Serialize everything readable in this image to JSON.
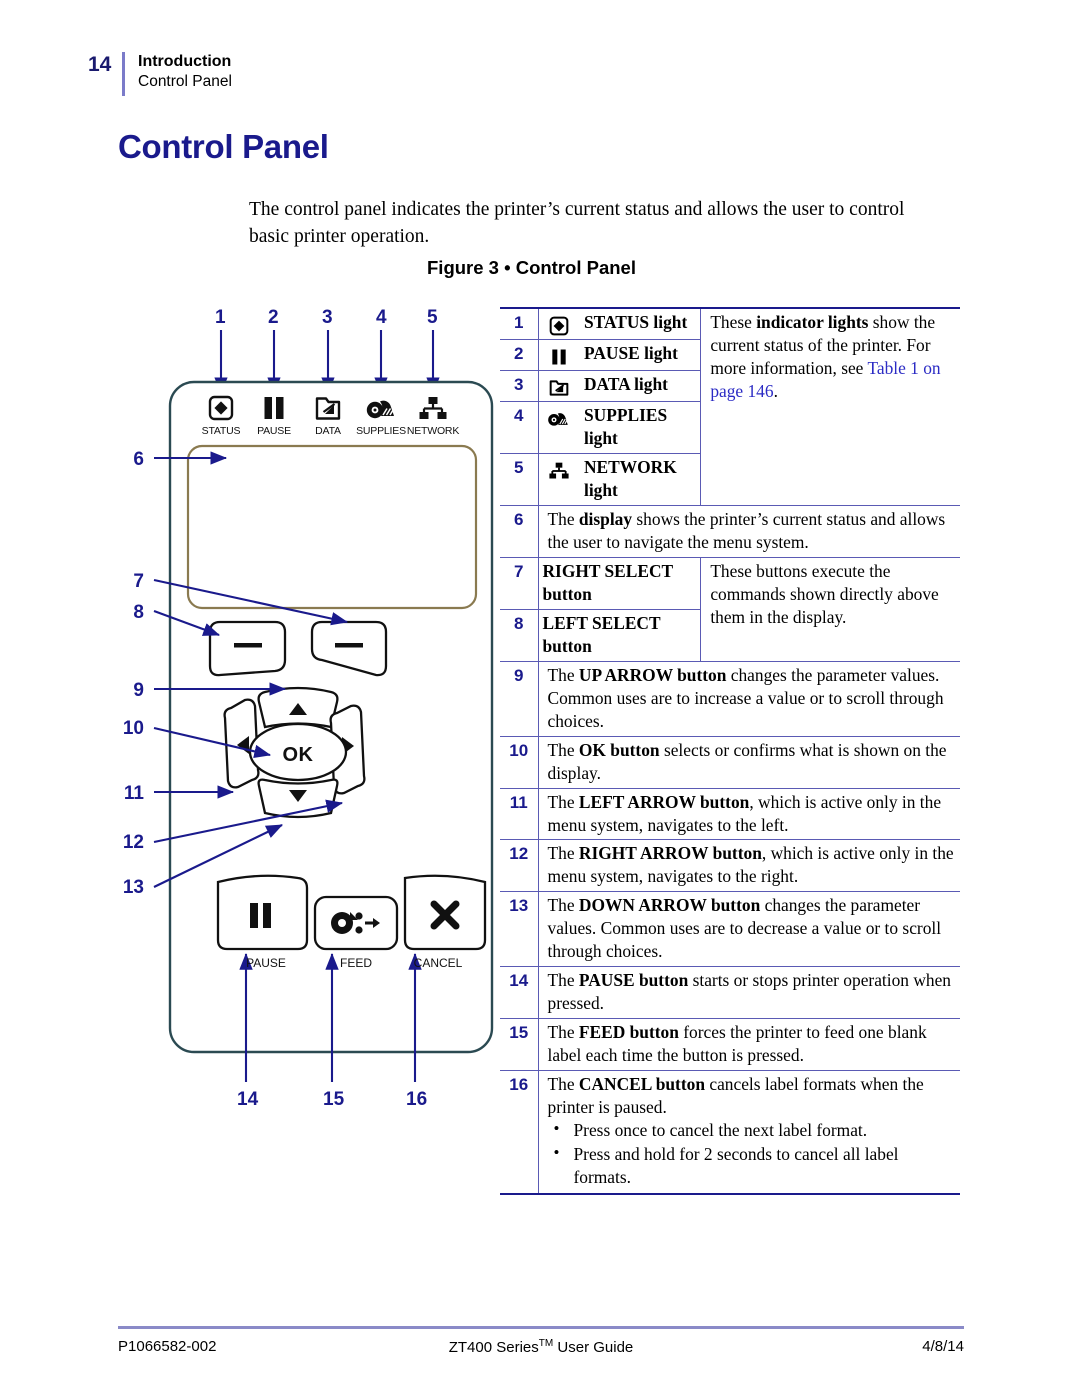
{
  "header": {
    "page_number": "14",
    "chapter": "Introduction",
    "section": "Control Panel"
  },
  "page_title": "Control Panel",
  "intro_paragraph": "The control panel indicates the printer’s current status and allows the user to control basic printer operation.",
  "figure": {
    "caption": "Figure 3 • Control Panel",
    "indicator_labels": [
      "STATUS",
      "PAUSE",
      "DATA",
      "SUPPLIES",
      "NETWORK"
    ],
    "button_labels": [
      "PAUSE",
      "FEED",
      "CANCEL"
    ],
    "ok_button_label": "OK",
    "callouts_top": [
      "1",
      "2",
      "3",
      "4",
      "5"
    ],
    "callouts_left": [
      "6",
      "7",
      "8",
      "9",
      "10",
      "11",
      "12",
      "13"
    ],
    "callouts_bottom": [
      "14",
      "15",
      "16"
    ]
  },
  "table": {
    "rows": [
      {
        "num": "1",
        "icon": "status-diamond-icon",
        "label": "STATUS light"
      },
      {
        "num": "2",
        "icon": "pause-bars-icon",
        "label": "PAUSE light"
      },
      {
        "num": "3",
        "icon": "data-folder-icon",
        "label": "DATA light"
      },
      {
        "num": "4",
        "icon": "supplies-roll-icon",
        "label": "SUPPLIES light"
      },
      {
        "num": "5",
        "icon": "network-tree-icon",
        "label": "NETWORK light"
      }
    ],
    "lights_description_1": "These ",
    "lights_description_bold": "indicator lights",
    "lights_description_2": " show the current status of the printer. For more information, see ",
    "lights_link": "Table 1 on page 146",
    "lights_description_3": ".",
    "row6": {
      "num": "6",
      "pre": "The ",
      "bold": "display",
      "post": " shows the printer’s current status and allows the user to navigate the menu system."
    },
    "row7": {
      "num": "7",
      "label": "RIGHT SELECT button"
    },
    "row8": {
      "num": "8",
      "label": "LEFT SELECT button"
    },
    "select_description": "These buttons execute the commands shown directly above them in the display.",
    "row9": {
      "num": "9",
      "pre": "The ",
      "bold": "UP ARROW button",
      "post": " changes the parameter values. Common uses are to increase a value or to scroll through choices."
    },
    "row10": {
      "num": "10",
      "pre": "The ",
      "bold": "OK button",
      "post": " selects or confirms what is shown on the display."
    },
    "row11": {
      "num": "11",
      "pre": "The ",
      "bold": "LEFT ARROW button",
      "post": ", which is active only in the menu system, navigates to the left."
    },
    "row12": {
      "num": "12",
      "pre": "The ",
      "bold": "RIGHT ARROW button",
      "post": ", which is active only in the menu system, navigates to the right."
    },
    "row13": {
      "num": "13",
      "pre": "The ",
      "bold": "DOWN ARROW button",
      "post": " changes the parameter values. Common uses are to decrease a value or to scroll through choices."
    },
    "row14": {
      "num": "14",
      "pre": "The ",
      "bold": "PAUSE button",
      "post": " starts or stops printer operation when pressed."
    },
    "row15": {
      "num": "15",
      "pre": "The ",
      "bold": "FEED button",
      "post": " forces the printer to feed one blank label each time the button is pressed."
    },
    "row16": {
      "num": "16",
      "pre": "The ",
      "bold": "CANCEL button",
      "post": " cancels label formats when the printer is paused.",
      "bullets": [
        "Press once to cancel the next label format.",
        "Press and hold for 2 seconds to cancel all label formats."
      ]
    }
  },
  "footer": {
    "left": "P1066582-002",
    "center_pre": "ZT400 Series",
    "center_tm": "TM",
    "center_post": " User Guide",
    "right": "4/8/14"
  },
  "colors": {
    "heading_blue": "#1a1a8c",
    "callout_blue": "#1a1a8c",
    "link_blue": "#2b2bc4",
    "rule_violet": "#5a5ab4",
    "panel_outline": "#2b4a52",
    "display_outline": "#8a7a50"
  }
}
